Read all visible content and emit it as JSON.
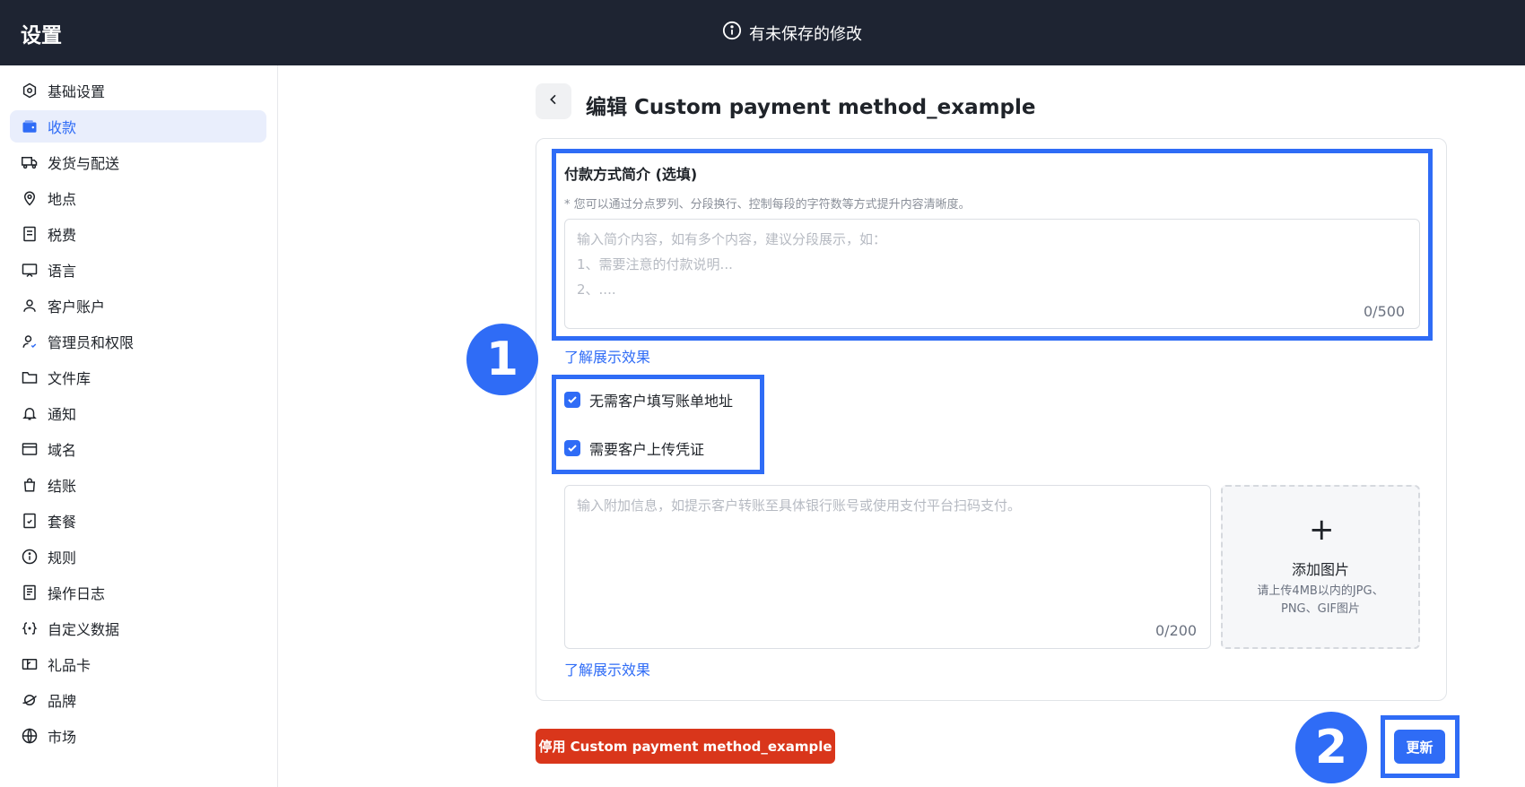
{
  "header": {
    "title": "设置",
    "unsaved_text": "有未保存的修改"
  },
  "sidebar": {
    "items": [
      {
        "label": "基础设置",
        "icon": "hexagon-settings-icon"
      },
      {
        "label": "收款",
        "icon": "wallet-icon",
        "active": true
      },
      {
        "label": "发货与配送",
        "icon": "truck-icon"
      },
      {
        "label": "地点",
        "icon": "location-pin-icon"
      },
      {
        "label": "税费",
        "icon": "receipt-icon"
      },
      {
        "label": "语言",
        "icon": "language-icon"
      },
      {
        "label": "客户账户",
        "icon": "user-icon"
      },
      {
        "label": "管理员和权限",
        "icon": "user-permission-icon"
      },
      {
        "label": "文件库",
        "icon": "folder-icon"
      },
      {
        "label": "通知",
        "icon": "bell-icon"
      },
      {
        "label": "域名",
        "icon": "domain-icon"
      },
      {
        "label": "结账",
        "icon": "bag-icon"
      },
      {
        "label": "套餐",
        "icon": "plan-icon"
      },
      {
        "label": "规则",
        "icon": "info-circle-icon"
      },
      {
        "label": "操作日志",
        "icon": "log-icon"
      },
      {
        "label": "自定义数据",
        "icon": "custom-data-icon"
      },
      {
        "label": "礼品卡",
        "icon": "gift-card-icon"
      },
      {
        "label": "品牌",
        "icon": "brand-icon"
      },
      {
        "label": "市场",
        "icon": "globe-icon"
      }
    ]
  },
  "page": {
    "title": "编辑 Custom payment method_example"
  },
  "intro": {
    "label": "付款方式简介 (选填)",
    "hint": "* 您可以通过分点罗列、分段换行、控制每段的字符数等方式提升内容清晰度。",
    "placeholder_lines": [
      "输入简介内容，如有多个内容，建议分段展示，如：",
      "1、需要注意的付款说明...",
      "2、...."
    ],
    "counter": "0/500",
    "link": "了解展示效果"
  },
  "options": {
    "no_billing_address": {
      "label": "无需客户填写账单地址",
      "checked": true
    },
    "upload_proof": {
      "label": "需要客户上传凭证",
      "checked": true
    }
  },
  "extra": {
    "placeholder": "输入附加信息，如提示客户转账至具体银行账号或使用支付平台扫码支付。",
    "counter": "0/200",
    "link": "了解展示效果"
  },
  "upload": {
    "plus": "+",
    "label": "添加图片",
    "hint_line1": "请上传4MB以内的JPG、",
    "hint_line2": "PNG、GIF图片"
  },
  "actions": {
    "disable_label": "停用 Custom payment method_example",
    "update_label": "更新"
  },
  "annotations": {
    "badge_1": "1",
    "badge_2": "2"
  },
  "colors": {
    "topbar": "#1e2432",
    "accent": "#2f6cf6",
    "danger": "#d9361b",
    "active_bg": "#e9eefc"
  }
}
